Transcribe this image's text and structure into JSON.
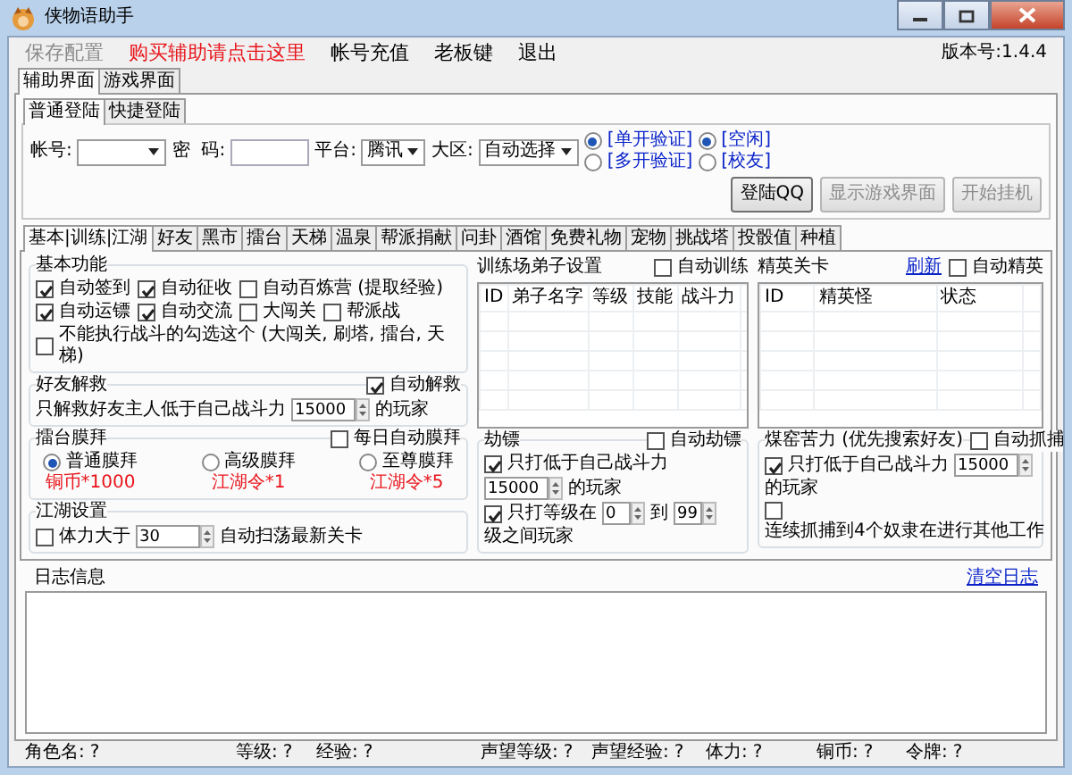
{
  "window": {
    "title": "侠物语助手"
  },
  "menu": [
    {
      "label": "保存配置",
      "kind": "normal",
      "disabled": true
    },
    {
      "label": "购买辅助请点击这里",
      "kind": "promo",
      "disabled": false
    },
    {
      "label": "帐号充值",
      "kind": "normal",
      "disabled": false
    },
    {
      "label": "老板键",
      "kind": "normal",
      "disabled": false
    },
    {
      "label": "退出",
      "kind": "normal",
      "disabled": false
    }
  ],
  "version": "版本号:1.4.4",
  "main_tabs": [
    {
      "label": "辅助界面",
      "selected": true
    },
    {
      "label": "游戏界面",
      "selected": false
    }
  ],
  "login_tabs": [
    {
      "label": "普通登陆",
      "selected": true
    },
    {
      "label": "快捷登陆",
      "selected": false
    }
  ],
  "login": {
    "account_label": "帐号:",
    "password_label": "密  码:",
    "platform_label": "平台:",
    "platform": "腾讯",
    "region_label": "大区:",
    "region": "自动选择",
    "verify_options": [
      {
        "label": "[单开验证]",
        "selected": true
      },
      {
        "label": "[多开验证]",
        "selected": false
      }
    ],
    "mode_options": [
      {
        "label": "[空闲]",
        "selected": true
      },
      {
        "label": "[校友]",
        "selected": false
      }
    ],
    "buttons": [
      {
        "label": "登陆QQ",
        "disabled": false
      },
      {
        "label": "显示游戏界面",
        "disabled": true
      },
      {
        "label": "开始挂机",
        "disabled": true
      }
    ]
  },
  "function_tabs": [
    {
      "label": "基本|训练|江湖",
      "selected": true
    },
    {
      "label": "好友",
      "selected": false
    },
    {
      "label": "黑市",
      "selected": false
    },
    {
      "label": "擂台",
      "selected": false
    },
    {
      "label": "天梯",
      "selected": false
    },
    {
      "label": "温泉",
      "selected": false
    },
    {
      "label": "帮派捐献",
      "selected": false
    },
    {
      "label": "问卦",
      "selected": false
    },
    {
      "label": "酒馆",
      "selected": false
    },
    {
      "label": "免费礼物",
      "selected": false
    },
    {
      "label": "宠物",
      "selected": false
    },
    {
      "label": "挑战塔",
      "selected": false
    },
    {
      "label": "投骰值",
      "selected": false
    },
    {
      "label": "种植",
      "selected": false
    }
  ],
  "basic": {
    "title": "基本功能",
    "rows": [
      [
        {
          "label": "自动签到",
          "checked": true
        },
        {
          "label": "自动征收",
          "checked": true
        },
        {
          "label": "自动百炼营 (提取经验)",
          "checked": false
        }
      ],
      [
        {
          "label": "自动运镖",
          "checked": true
        },
        {
          "label": "自动交流",
          "checked": true
        },
        {
          "label": "大闯关",
          "checked": false
        },
        {
          "label": "帮派战",
          "checked": false
        }
      ],
      [
        {
          "label": "不能执行战斗的勾选这个 (大闯关, 刷塔, 擂台, 天梯)",
          "checked": false
        }
      ]
    ]
  },
  "friend_rescue": {
    "title": "好友解救",
    "auto": {
      "label": "自动解救",
      "checked": true
    },
    "rows": [
      {
        "kind": "text",
        "before": "只解救好友主人低于自己战斗力",
        "value": "15000",
        "after": "的玩家"
      }
    ]
  },
  "arena": {
    "title": "擂台膜拜",
    "auto": {
      "label": "每日自动膜拜",
      "checked": false
    },
    "options": [
      {
        "label": "普通膜拜",
        "cost": "铜币*1000",
        "selected": true
      },
      {
        "label": "高级膜拜",
        "cost": "江湖令*1",
        "selected": false
      },
      {
        "label": "至尊膜拜",
        "cost": "江湖令*5",
        "selected": false
      }
    ]
  },
  "jianghu": {
    "title": "江湖设置",
    "rows": [
      {
        "kind": "single",
        "checked": false,
        "before": "体力大于",
        "value": "30",
        "after": "自动扫荡最新关卡"
      }
    ]
  },
  "training": {
    "title": "训练场弟子设置",
    "auto": {
      "label": "自动训练",
      "checked": false
    },
    "columns": [
      "ID",
      "弟子名字",
      "等级",
      "技能",
      "战斗力"
    ]
  },
  "escort": {
    "title": "劫镖",
    "auto": {
      "label": "自动劫镖",
      "checked": false
    },
    "rows": [
      {
        "kind": "single",
        "checked": true,
        "before": "只打低于自己战斗力",
        "value": "15000",
        "after": "的玩家"
      },
      {
        "kind": "range",
        "checked": true,
        "before": "只打等级在",
        "value": "0",
        "middle": "到",
        "value2": "99",
        "after": "级之间玩家"
      }
    ]
  },
  "elite": {
    "title": "精英关卡",
    "refresh": "刷新",
    "auto": {
      "label": "自动精英",
      "checked": false
    },
    "columns": [
      "ID",
      "精英怪",
      "状态"
    ]
  },
  "coolie": {
    "title": "煤窑苦力 (优先搜索好友)",
    "auto": {
      "label": "自动抓捕",
      "checked": false
    },
    "rows": [
      {
        "kind": "single",
        "checked": true,
        "before": "只打低于自己战斗力",
        "value": "15000",
        "after": "的玩家"
      },
      {
        "kind": "plain",
        "checked": false,
        "label": "连续抓捕到4个奴隶在进行其他工作"
      }
    ]
  },
  "log": {
    "title": "日志信息",
    "clear": "清空日志"
  },
  "status_bar": [
    {
      "label": "角色名:",
      "value": "?"
    },
    {
      "label": "等级:",
      "value": "?"
    },
    {
      "label": "经验:",
      "value": "?"
    },
    {
      "label": "声望等级:",
      "value": "?"
    },
    {
      "label": "声望经验:",
      "value": "?"
    },
    {
      "label": "体力:",
      "value": "?"
    },
    {
      "label": "铜币:",
      "value": "?"
    },
    {
      "label": "令牌:",
      "value": "?"
    }
  ]
}
